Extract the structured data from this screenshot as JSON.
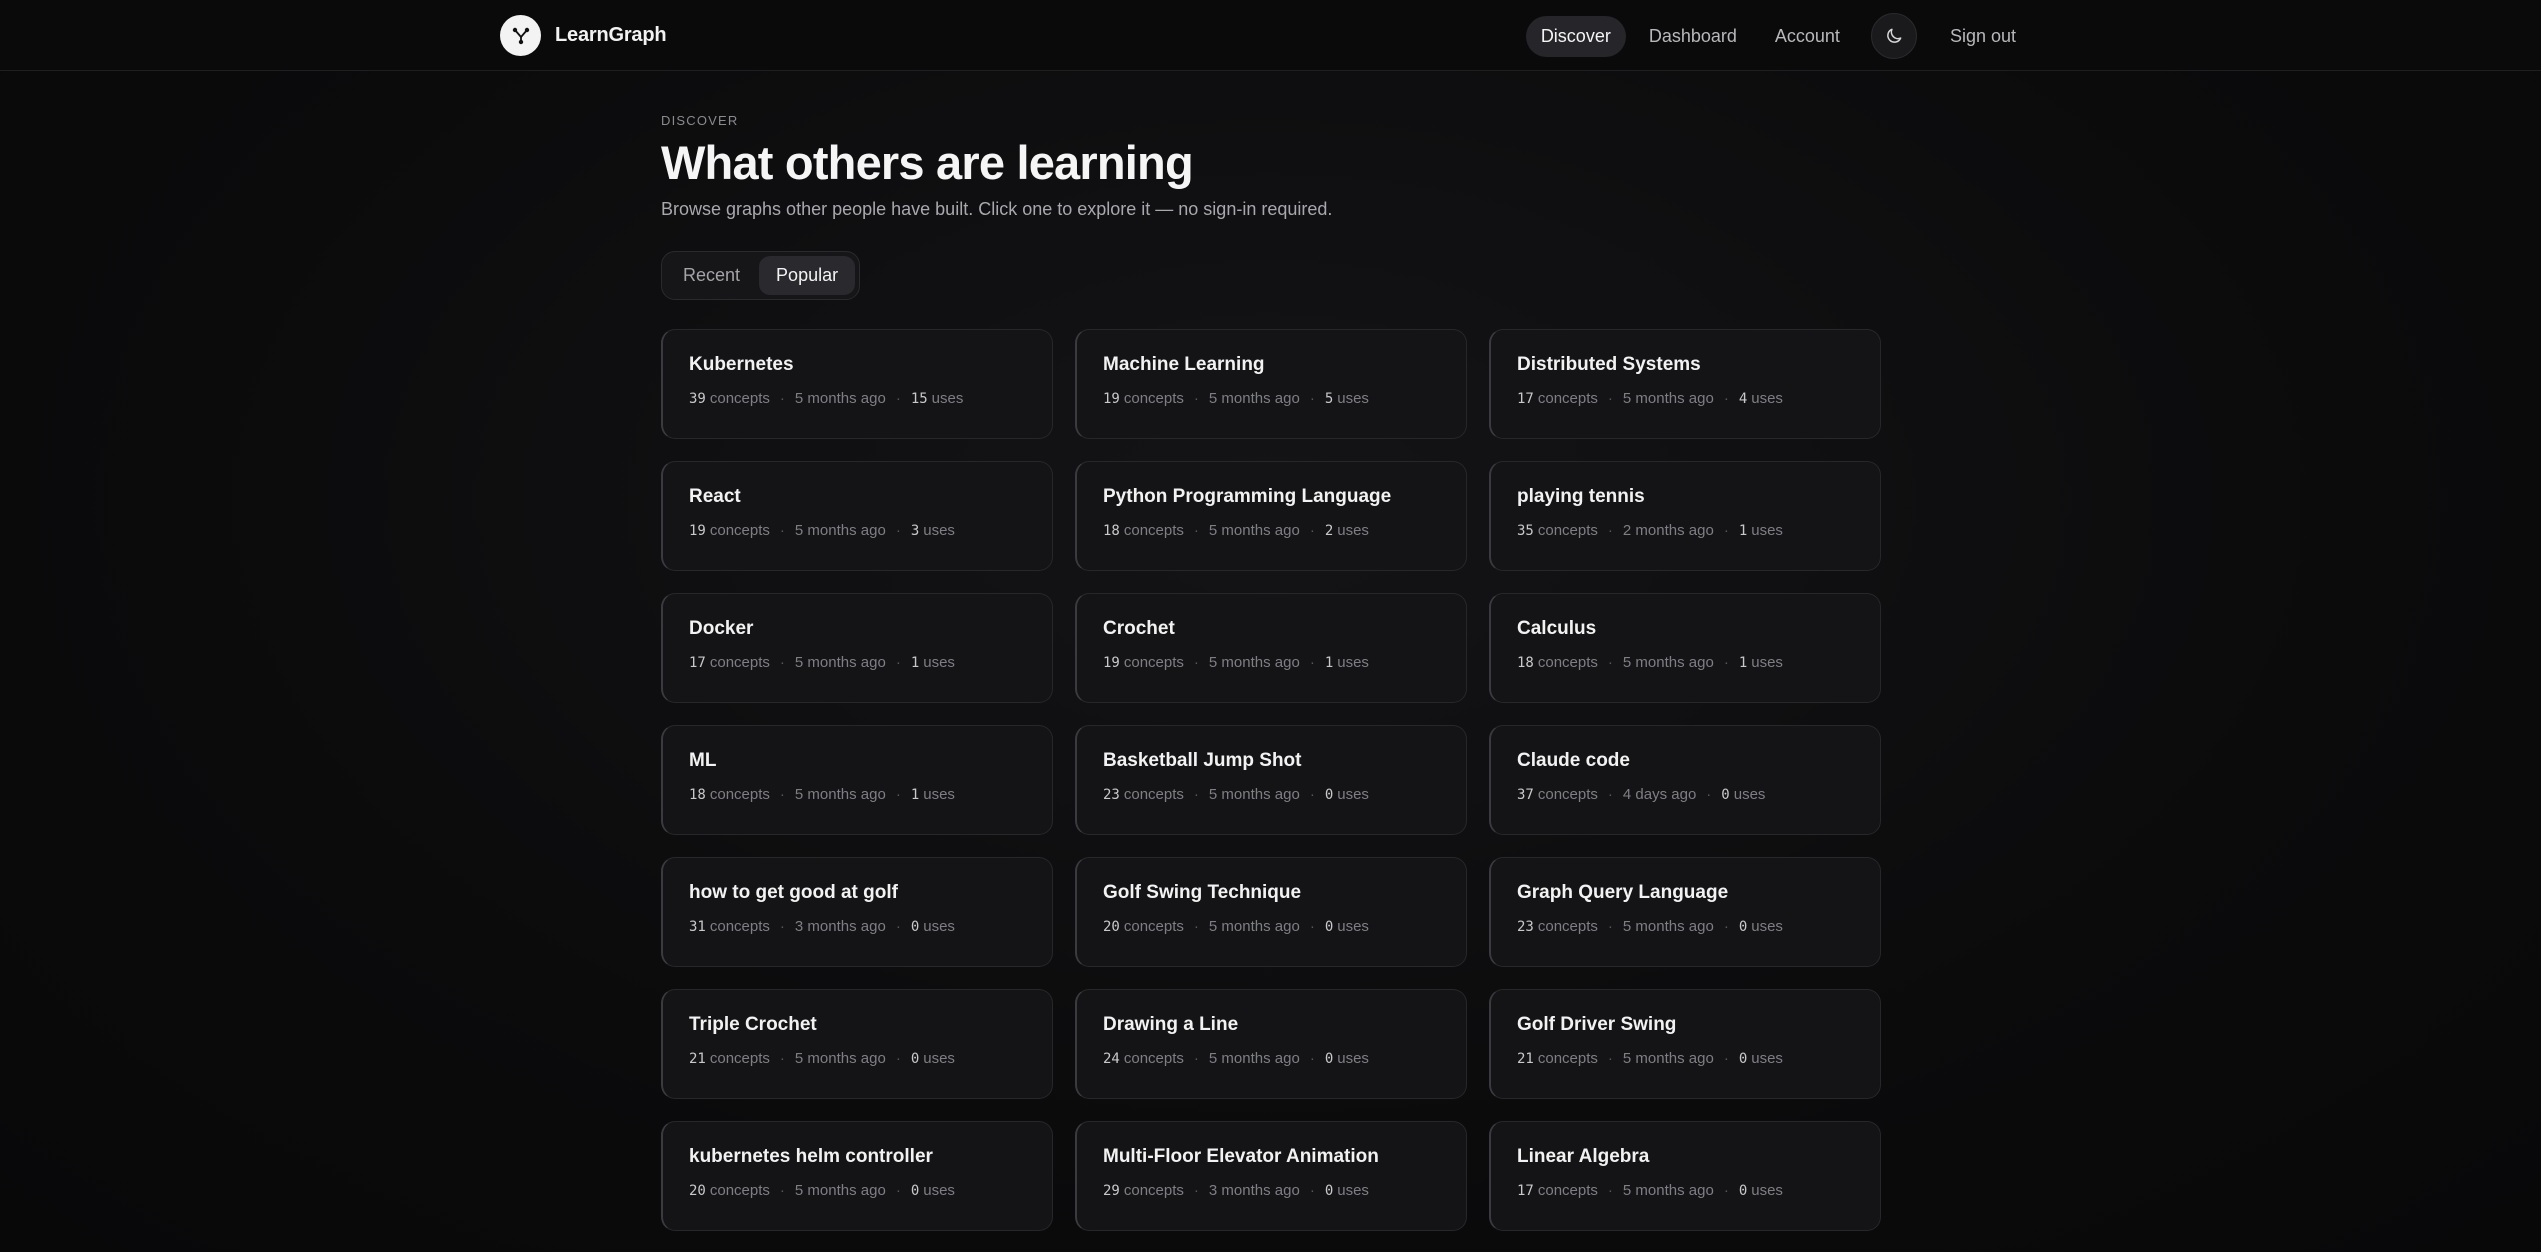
{
  "nav": {
    "brand": "LearnGraph",
    "links": [
      "Discover",
      "Dashboard",
      "Account"
    ],
    "signout": "Sign out",
    "logo_icon": "graph-logo-icon",
    "theme_icon": "moon-icon"
  },
  "header": {
    "eyebrow": "DISCOVER",
    "title": "What others are learning",
    "subtitle": "Browse graphs other people have built. Click one to explore it — no sign-in required."
  },
  "tabs": {
    "items": [
      "Recent",
      "Popular"
    ],
    "active": "Popular"
  },
  "labels": {
    "concepts": "concepts",
    "uses": "uses",
    "separator": "·"
  },
  "cards": [
    {
      "title": "Kubernetes",
      "concepts": "39",
      "time": "5 months ago",
      "uses": "15"
    },
    {
      "title": "Machine Learning",
      "concepts": "19",
      "time": "5 months ago",
      "uses": "5"
    },
    {
      "title": "Distributed Systems",
      "concepts": "17",
      "time": "5 months ago",
      "uses": "4"
    },
    {
      "title": "React",
      "concepts": "19",
      "time": "5 months ago",
      "uses": "3"
    },
    {
      "title": "Python Programming Language",
      "concepts": "18",
      "time": "5 months ago",
      "uses": "2"
    },
    {
      "title": "playing tennis",
      "concepts": "35",
      "time": "2 months ago",
      "uses": "1"
    },
    {
      "title": "Docker",
      "concepts": "17",
      "time": "5 months ago",
      "uses": "1"
    },
    {
      "title": "Crochet",
      "concepts": "19",
      "time": "5 months ago",
      "uses": "1"
    },
    {
      "title": "Calculus",
      "concepts": "18",
      "time": "5 months ago",
      "uses": "1"
    },
    {
      "title": "ML",
      "concepts": "18",
      "time": "5 months ago",
      "uses": "1"
    },
    {
      "title": "Basketball Jump Shot",
      "concepts": "23",
      "time": "5 months ago",
      "uses": "0"
    },
    {
      "title": "Claude code",
      "concepts": "37",
      "time": "4 days ago",
      "uses": "0"
    },
    {
      "title": "how to get good at golf",
      "concepts": "31",
      "time": "3 months ago",
      "uses": "0"
    },
    {
      "title": "Golf Swing Technique",
      "concepts": "20",
      "time": "5 months ago",
      "uses": "0"
    },
    {
      "title": "Graph Query Language",
      "concepts": "23",
      "time": "5 months ago",
      "uses": "0"
    },
    {
      "title": "Triple Crochet",
      "concepts": "21",
      "time": "5 months ago",
      "uses": "0"
    },
    {
      "title": "Drawing a Line",
      "concepts": "24",
      "time": "5 months ago",
      "uses": "0"
    },
    {
      "title": "Golf Driver Swing",
      "concepts": "21",
      "time": "5 months ago",
      "uses": "0"
    },
    {
      "title": "kubernetes helm controller",
      "concepts": "20",
      "time": "5 months ago",
      "uses": "0"
    },
    {
      "title": "Multi-Floor Elevator Animation",
      "concepts": "29",
      "time": "3 months ago",
      "uses": "0"
    },
    {
      "title": "Linear Algebra",
      "concepts": "17",
      "time": "5 months ago",
      "uses": "0"
    }
  ]
}
